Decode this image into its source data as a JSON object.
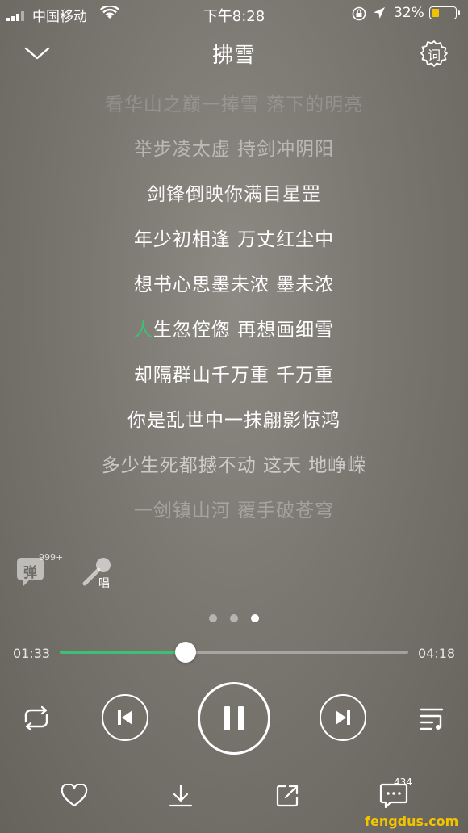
{
  "status_bar": {
    "carrier": "中国移动",
    "time": "下午8:28",
    "battery_percent": "32%",
    "battery_level": 0.32
  },
  "header": {
    "title": "拂雪",
    "lyrics_button_label": "词"
  },
  "lyrics": [
    "看华山之巅一捧雪 落下的明亮",
    "举步凌太虚 持剑冲阴阳",
    "剑锋倒映你满目星罡",
    "年少初相逢 万丈红尘中",
    "想书心思墨未浓 墨未浓",
    "生忽倥偬 再想画细雪",
    "却隔群山千万重 千万重",
    "你是乱世中一抹翩影惊鸿",
    "多少生死都撼不动 这天 地峥嵘",
    "一剑镇山河 覆手破苍穹"
  ],
  "current_line_highlight": "人",
  "extras": {
    "danmu_label": "弹",
    "danmu_count": "999+",
    "sing_label": "唱"
  },
  "pager": {
    "count": 3,
    "active": 2
  },
  "playback": {
    "current_time": "01:33",
    "total_time": "04:18",
    "progress": 0.36
  },
  "bottom": {
    "comment_count": "434"
  },
  "watermark": "fengdus.com",
  "colors": {
    "accent": "#3fbf74"
  }
}
